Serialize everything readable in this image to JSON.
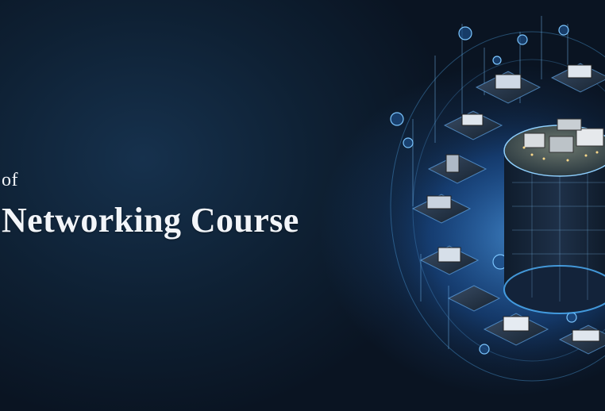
{
  "hero": {
    "title_line1": "of",
    "title_line2": "Networking Course"
  },
  "colors": {
    "background": "#0a1320",
    "title_text": "#f2f5f9",
    "glow": "#2f8fff",
    "cyan_ring": "#4fb4ff"
  },
  "illustration": {
    "subject": "isometric-network-data-center-hub",
    "icons": [
      "laptop-icon",
      "server-icon",
      "monitor-icon",
      "router-icon",
      "cloud-icon",
      "globe-icon"
    ]
  }
}
